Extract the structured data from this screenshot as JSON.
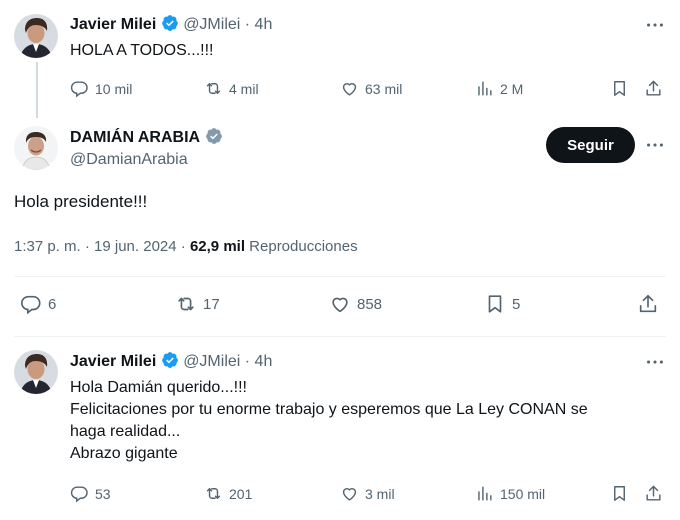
{
  "tweets": [
    {
      "author_name": "Javier Milei",
      "handle": "@JMilei",
      "time": "· 4h",
      "lines": [
        "HOLA A TODOS...!!!"
      ],
      "replies": "10 mil",
      "retweets": "4 mil",
      "likes": "63 mil",
      "views": "2 M"
    },
    {
      "author_name": "DAMIÁN ARABIA",
      "handle": "@DamianArabia",
      "follow_label": "Seguir",
      "text": "Hola presidente!!!",
      "timestamp": "1:37 p. m. · 19 jun. 2024 ·",
      "views_count": "62,9 mil",
      "views_label": "Reproducciones",
      "replies": "6",
      "retweets": "17",
      "likes": "858",
      "bookmarks": "5"
    },
    {
      "author_name": "Javier Milei",
      "handle": "@JMilei",
      "time": "· 4h",
      "lines": [
        "Hola Damián querido...!!!",
        "Felicitaciones por tu enorme trabajo y esperemos que La Ley CONAN se",
        "haga realidad...",
        "Abrazo gigante"
      ],
      "replies": "53",
      "retweets": "201",
      "likes": "3 mil",
      "views": "150 mil"
    }
  ],
  "colors": {
    "text": "#0f1419",
    "muted": "#536471",
    "verified_blue": "#1d9bf0",
    "verified_gray": "#829aab",
    "divider": "#eff3f4"
  }
}
